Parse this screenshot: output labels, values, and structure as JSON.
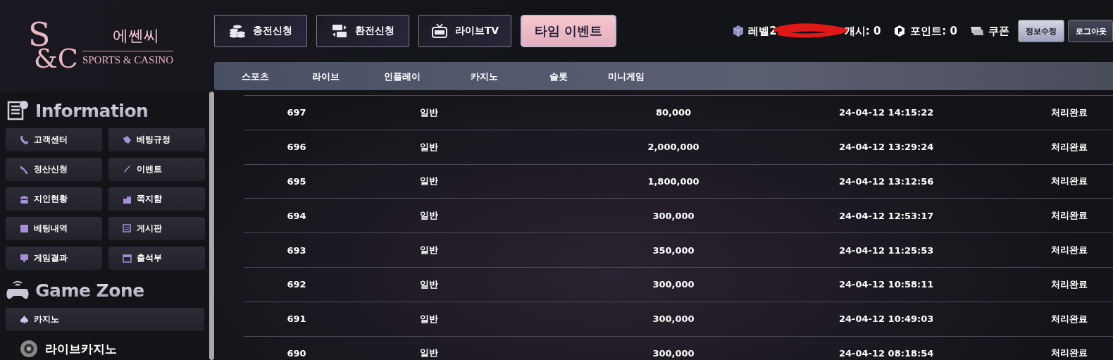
{
  "logo": {
    "monogram_top": "S",
    "monogram_bottom": "&C",
    "name": "에쎈씨",
    "tagline": "SPORTS & CASINO"
  },
  "top_buttons": [
    {
      "label": "충전신청",
      "highlighted": false
    },
    {
      "label": "환전신청",
      "highlighted": false
    },
    {
      "label": "라이브TV",
      "highlighted": false
    },
    {
      "label": "타임 이벤트",
      "highlighted": true
    }
  ],
  "nav": [
    "스포츠",
    "라이브",
    "인플레이",
    "카지노",
    "슬롯",
    "미니게임"
  ],
  "user_bar": {
    "level": "레벨2",
    "posts": "개시: 0",
    "points": "포인트: 0",
    "coupon": "쿠폰",
    "buttons": [
      "정보수정",
      "로그아웃"
    ]
  },
  "sidebar": {
    "sections": [
      {
        "title": "Information",
        "items": [
          "고객센터",
          "베팅규정",
          "정산신청",
          "이벤트",
          "지인현황",
          "쪽지함",
          "베팅내역",
          "게시판",
          "게임결과",
          "출석부"
        ]
      },
      {
        "title": "Game Zone",
        "items": [
          "카지노"
        ],
        "extra": "라이브카지노"
      }
    ]
  },
  "table": {
    "rows": [
      [
        "697",
        "일반",
        "80,000",
        "24-04-12 14:15:22",
        "처리완료"
      ],
      [
        "696",
        "일반",
        "2,000,000",
        "24-04-12 13:29:24",
        "처리완료"
      ],
      [
        "695",
        "일반",
        "1,800,000",
        "24-04-12 13:12:56",
        "처리완료"
      ],
      [
        "694",
        "일반",
        "300,000",
        "24-04-12 12:53:17",
        "처리완료"
      ],
      [
        "693",
        "일반",
        "350,000",
        "24-04-12 11:25:53",
        "처리완료"
      ],
      [
        "692",
        "일반",
        "300,000",
        "24-04-12 10:58:11",
        "처리완료"
      ],
      [
        "691",
        "일반",
        "300,000",
        "24-04-12 10:49:03",
        "처리완료"
      ],
      [
        "690",
        "일반",
        "300,000",
        "24-04-12 08:18:54",
        "처리완료"
      ]
    ]
  }
}
